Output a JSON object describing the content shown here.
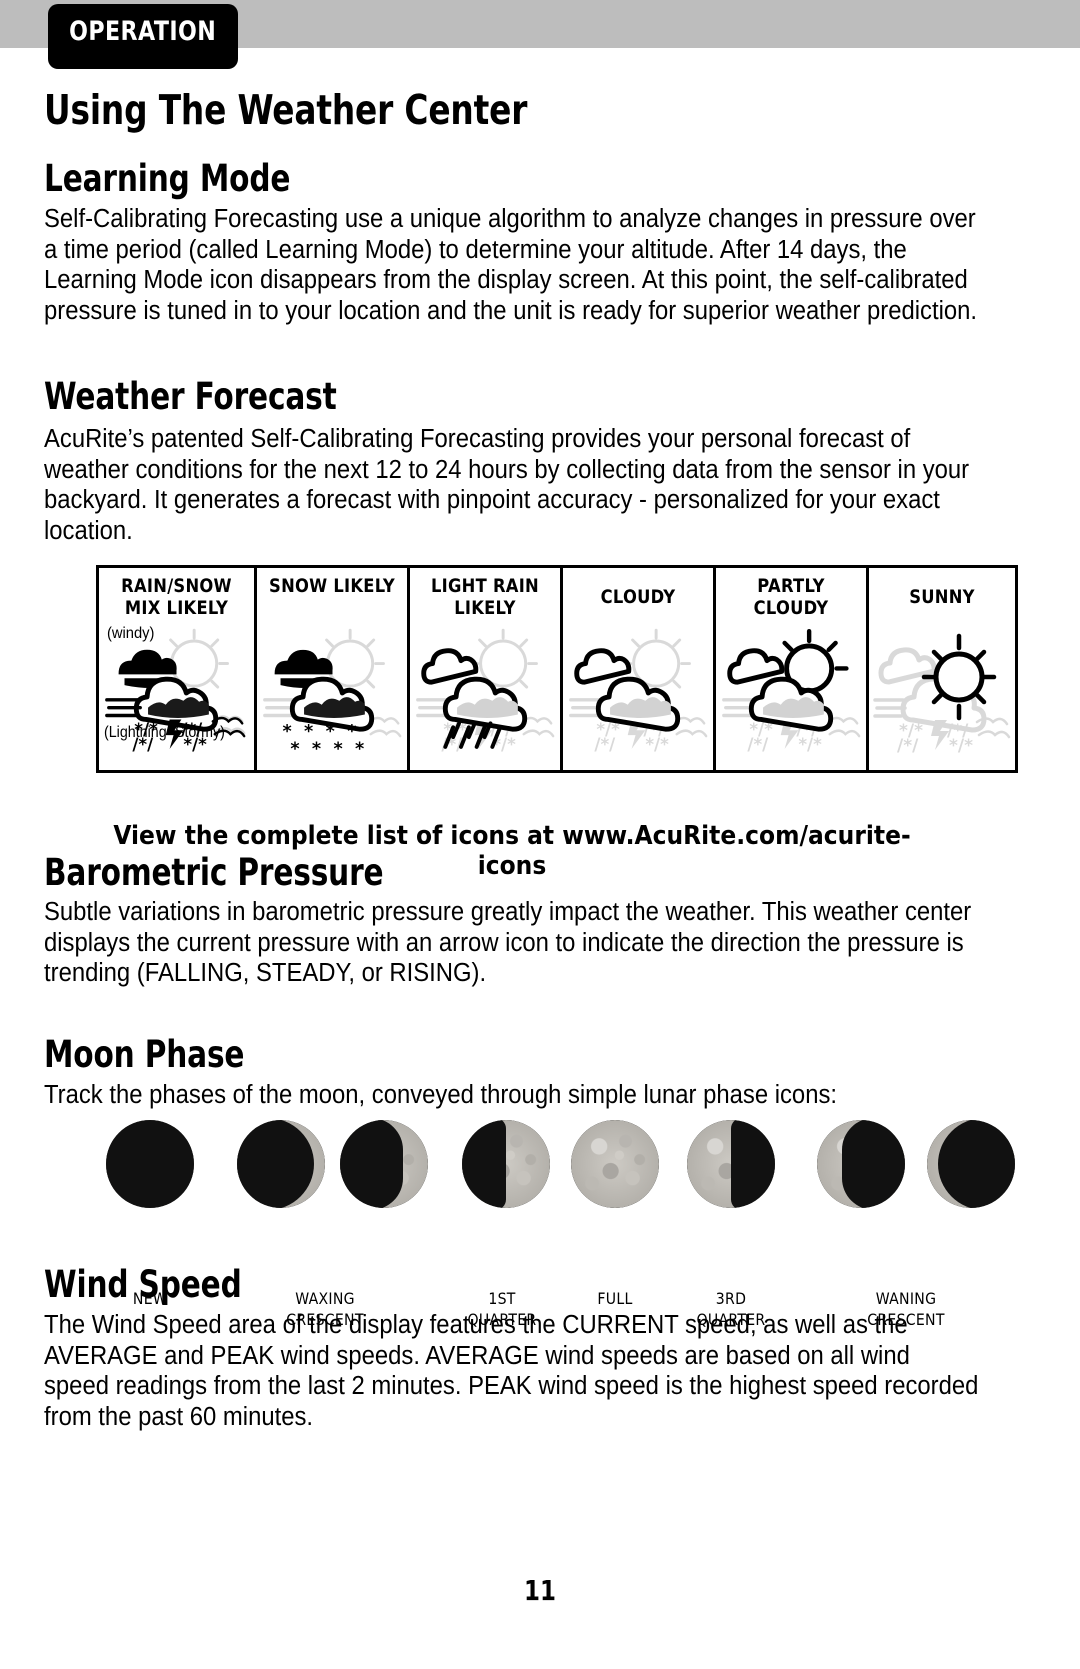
{
  "header": {
    "section_tab": "OPERATION",
    "band_color": "#bdbdbd",
    "tab_bg": "#000000",
    "tab_text_color": "#ffffff"
  },
  "page_title": "Using The Weather Center",
  "sections": [
    {
      "heading": "Learning Mode",
      "body": "Self-Calibrating Forecasting use a unique algorithm to analyze changes in pressure over a time period (called Learning Mode) to determine your altitude. After 14 days, the Learning Mode icon disappears from the display screen. At this point, the self-calibrated pressure is tuned in to your location and the unit is ready for superior weather prediction."
    },
    {
      "heading": "Weather Forecast",
      "body": "AcuRite’s patented Self-Calibrating Forecasting provides your personal forecast of weather conditions for the next 12 to 24 hours by collecting data from the sensor in your backyard. It generates a forecast with pinpoint accuracy - personalized for your exact location."
    },
    {
      "heading": "Barometric Pressure",
      "body": "Subtle variations in barometric pressure greatly impact the weather. This weather center displays the current pressure with an arrow icon to indicate the direction the pressure is trending (FALLING, STEADY, or RISING)."
    },
    {
      "heading": "Moon Phase",
      "body": "Track the phases of the moon, conveyed through simple lunar phase icons:"
    },
    {
      "heading": "Wind Speed",
      "body": "The Wind Speed area of the display features the CURRENT speed, as well as the AVERAGE and PEAK wind speeds. AVERAGE wind speeds are based on all wind speed readings from the last 2 minutes. PEAK wind speed is the highest speed recorded from the past 60 minutes."
    }
  ],
  "forecast_table": {
    "cells": [
      {
        "title": "RAIN/SNOW MIX LIKELY",
        "note_top": "(windy)",
        "note_bottom": "(Lightning=Stormy)",
        "icon": "rain-snow-mix-windy-icon"
      },
      {
        "title": "SNOW LIKELY",
        "note_top": "",
        "note_bottom": "",
        "icon": "snow-likely-icon"
      },
      {
        "title": "LIGHT RAIN LIKELY",
        "note_top": "",
        "note_bottom": "",
        "icon": "light-rain-likely-icon"
      },
      {
        "title": "CLOUDY",
        "note_top": "",
        "note_bottom": "",
        "icon": "cloudy-icon"
      },
      {
        "title": "PARTLY CLOUDY",
        "note_top": "",
        "note_bottom": "",
        "icon": "partly-cloudy-icon"
      },
      {
        "title": "SUNNY",
        "note_top": "",
        "note_bottom": "",
        "icon": "sunny-icon"
      }
    ]
  },
  "url_caption": "View the complete list of icons at www.AcuRite.com/acurite-icons",
  "moon_phases": {
    "icons": [
      {
        "name": "new-moon-icon",
        "illumination": 0.0,
        "lit_side": "right"
      },
      {
        "name": "waxing-crescent-moon-icon",
        "illumination": 0.12,
        "lit_side": "right"
      },
      {
        "name": "waxing-crescent-2-moon-icon",
        "illumination": 0.28,
        "lit_side": "right"
      },
      {
        "name": "first-quarter-moon-icon",
        "illumination": 0.5,
        "lit_side": "right"
      },
      {
        "name": "full-moon-icon",
        "illumination": 1.0,
        "lit_side": "right"
      },
      {
        "name": "third-quarter-moon-icon",
        "illumination": 0.5,
        "lit_side": "left"
      },
      {
        "name": "waning-crescent-moon-icon",
        "illumination": 0.28,
        "lit_side": "left"
      },
      {
        "name": "waning-crescent-2-moon-icon",
        "illumination": 0.12,
        "lit_side": "left"
      }
    ],
    "labels": [
      {
        "text": "NEW",
        "center": 98
      },
      {
        "text": "WAXING CRESCENT",
        "center": 273
      },
      {
        "text": "1ST QUARTER",
        "center": 450
      },
      {
        "text": "FULL",
        "center": 563
      },
      {
        "text": "3RD QUARTER",
        "center": 679
      },
      {
        "text": "WANING CRESCENT",
        "center": 854
      }
    ]
  },
  "page_number": "11"
}
